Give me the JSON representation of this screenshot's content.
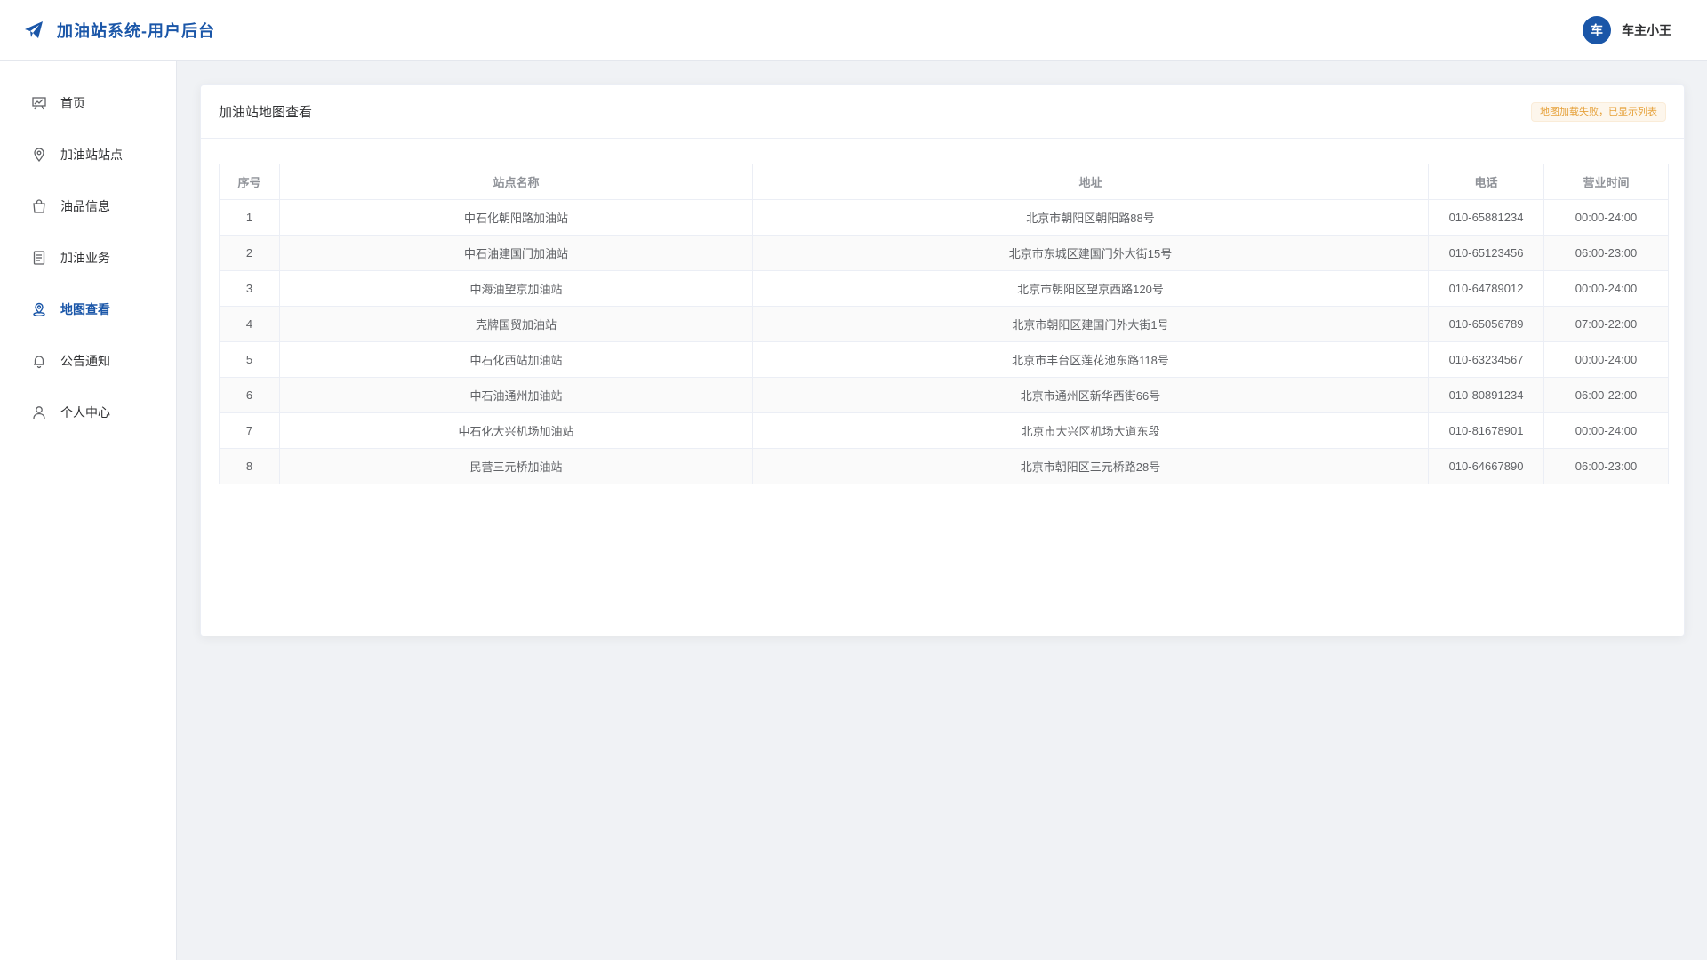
{
  "header": {
    "title": "加油站系统-用户后台",
    "logo_icon": "paper-plane-icon",
    "brand_color": "#1a56a8",
    "user": {
      "avatar_text": "车",
      "name": "车主小王"
    }
  },
  "sidebar": {
    "items": [
      {
        "label": "首页",
        "icon": "dashboard-icon",
        "active": false
      },
      {
        "label": "加油站站点",
        "icon": "location-pin-icon",
        "active": false
      },
      {
        "label": "油品信息",
        "icon": "shopping-bag-icon",
        "active": false
      },
      {
        "label": "加油业务",
        "icon": "document-icon",
        "active": false
      },
      {
        "label": "地图查看",
        "icon": "map-pin-icon",
        "active": true
      },
      {
        "label": "公告通知",
        "icon": "bell-icon",
        "active": false
      },
      {
        "label": "个人中心",
        "icon": "user-icon",
        "active": false
      }
    ]
  },
  "main": {
    "title": "加油站地图查看",
    "warning": "地图加载失败，已显示列表",
    "warning_color": "#e6a23c",
    "table": {
      "columns": [
        "序号",
        "站点名称",
        "地址",
        "电话",
        "营业时间"
      ],
      "rows": [
        [
          "1",
          "中石化朝阳路加油站",
          "北京市朝阳区朝阳路88号",
          "010-65881234",
          "00:00-24:00"
        ],
        [
          "2",
          "中石油建国门加油站",
          "北京市东城区建国门外大街15号",
          "010-65123456",
          "06:00-23:00"
        ],
        [
          "3",
          "中海油望京加油站",
          "北京市朝阳区望京西路120号",
          "010-64789012",
          "00:00-24:00"
        ],
        [
          "4",
          "壳牌国贸加油站",
          "北京市朝阳区建国门外大街1号",
          "010-65056789",
          "07:00-22:00"
        ],
        [
          "5",
          "中石化西站加油站",
          "北京市丰台区莲花池东路118号",
          "010-63234567",
          "00:00-24:00"
        ],
        [
          "6",
          "中石油通州加油站",
          "北京市通州区新华西街66号",
          "010-80891234",
          "06:00-22:00"
        ],
        [
          "7",
          "中石化大兴机场加油站",
          "北京市大兴区机场大道东段",
          "010-81678901",
          "00:00-24:00"
        ],
        [
          "8",
          "民营三元桥加油站",
          "北京市朝阳区三元桥路28号",
          "010-64667890",
          "06:00-23:00"
        ]
      ]
    }
  }
}
